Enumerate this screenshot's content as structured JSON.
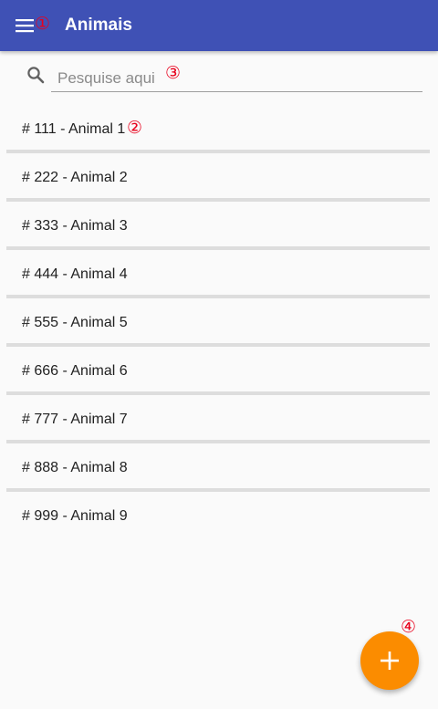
{
  "header": {
    "title": "Animais",
    "menu_icon": "menu-icon",
    "background_color": "#3f51b5"
  },
  "search": {
    "placeholder": "Pesquise aqui",
    "icon": "search-icon"
  },
  "animals": [
    {
      "label": "# 111 - Animal 1"
    },
    {
      "label": "# 222 - Animal 2"
    },
    {
      "label": "# 333 - Animal 3"
    },
    {
      "label": "# 444 - Animal 4"
    },
    {
      "label": "# 555 - Animal 5"
    },
    {
      "label": "# 666 - Animal 6"
    },
    {
      "label": "# 777 - Animal 7"
    },
    {
      "label": "# 888 - Animal 8"
    },
    {
      "label": "# 999 - Animal 9"
    }
  ],
  "fab": {
    "icon": "plus-icon",
    "color": "#fb8c00"
  },
  "annotations": {
    "marker_1": "①",
    "marker_2": "②",
    "marker_3": "③",
    "marker_4": "④",
    "color": "#e8001c"
  }
}
